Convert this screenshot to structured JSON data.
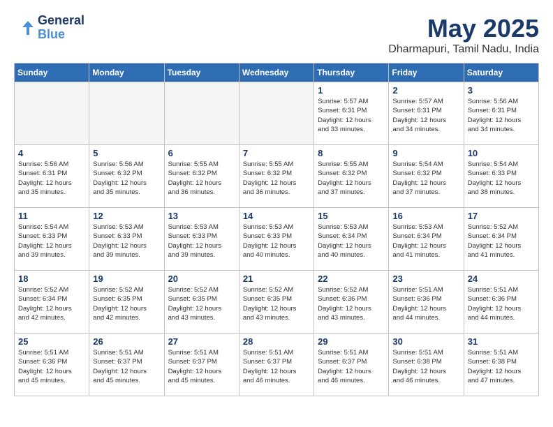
{
  "header": {
    "logo_line1": "General",
    "logo_line2": "Blue",
    "month": "May 2025",
    "location": "Dharmapuri, Tamil Nadu, India"
  },
  "weekdays": [
    "Sunday",
    "Monday",
    "Tuesday",
    "Wednesday",
    "Thursday",
    "Friday",
    "Saturday"
  ],
  "weeks": [
    [
      {
        "day": "",
        "info": ""
      },
      {
        "day": "",
        "info": ""
      },
      {
        "day": "",
        "info": ""
      },
      {
        "day": "",
        "info": ""
      },
      {
        "day": "1",
        "info": "Sunrise: 5:57 AM\nSunset: 6:31 PM\nDaylight: 12 hours\nand 33 minutes."
      },
      {
        "day": "2",
        "info": "Sunrise: 5:57 AM\nSunset: 6:31 PM\nDaylight: 12 hours\nand 34 minutes."
      },
      {
        "day": "3",
        "info": "Sunrise: 5:56 AM\nSunset: 6:31 PM\nDaylight: 12 hours\nand 34 minutes."
      }
    ],
    [
      {
        "day": "4",
        "info": "Sunrise: 5:56 AM\nSunset: 6:31 PM\nDaylight: 12 hours\nand 35 minutes."
      },
      {
        "day": "5",
        "info": "Sunrise: 5:56 AM\nSunset: 6:32 PM\nDaylight: 12 hours\nand 35 minutes."
      },
      {
        "day": "6",
        "info": "Sunrise: 5:55 AM\nSunset: 6:32 PM\nDaylight: 12 hours\nand 36 minutes."
      },
      {
        "day": "7",
        "info": "Sunrise: 5:55 AM\nSunset: 6:32 PM\nDaylight: 12 hours\nand 36 minutes."
      },
      {
        "day": "8",
        "info": "Sunrise: 5:55 AM\nSunset: 6:32 PM\nDaylight: 12 hours\nand 37 minutes."
      },
      {
        "day": "9",
        "info": "Sunrise: 5:54 AM\nSunset: 6:32 PM\nDaylight: 12 hours\nand 37 minutes."
      },
      {
        "day": "10",
        "info": "Sunrise: 5:54 AM\nSunset: 6:33 PM\nDaylight: 12 hours\nand 38 minutes."
      }
    ],
    [
      {
        "day": "11",
        "info": "Sunrise: 5:54 AM\nSunset: 6:33 PM\nDaylight: 12 hours\nand 39 minutes."
      },
      {
        "day": "12",
        "info": "Sunrise: 5:53 AM\nSunset: 6:33 PM\nDaylight: 12 hours\nand 39 minutes."
      },
      {
        "day": "13",
        "info": "Sunrise: 5:53 AM\nSunset: 6:33 PM\nDaylight: 12 hours\nand 39 minutes."
      },
      {
        "day": "14",
        "info": "Sunrise: 5:53 AM\nSunset: 6:33 PM\nDaylight: 12 hours\nand 40 minutes."
      },
      {
        "day": "15",
        "info": "Sunrise: 5:53 AM\nSunset: 6:34 PM\nDaylight: 12 hours\nand 40 minutes."
      },
      {
        "day": "16",
        "info": "Sunrise: 5:53 AM\nSunset: 6:34 PM\nDaylight: 12 hours\nand 41 minutes."
      },
      {
        "day": "17",
        "info": "Sunrise: 5:52 AM\nSunset: 6:34 PM\nDaylight: 12 hours\nand 41 minutes."
      }
    ],
    [
      {
        "day": "18",
        "info": "Sunrise: 5:52 AM\nSunset: 6:34 PM\nDaylight: 12 hours\nand 42 minutes."
      },
      {
        "day": "19",
        "info": "Sunrise: 5:52 AM\nSunset: 6:35 PM\nDaylight: 12 hours\nand 42 minutes."
      },
      {
        "day": "20",
        "info": "Sunrise: 5:52 AM\nSunset: 6:35 PM\nDaylight: 12 hours\nand 43 minutes."
      },
      {
        "day": "21",
        "info": "Sunrise: 5:52 AM\nSunset: 6:35 PM\nDaylight: 12 hours\nand 43 minutes."
      },
      {
        "day": "22",
        "info": "Sunrise: 5:52 AM\nSunset: 6:36 PM\nDaylight: 12 hours\nand 43 minutes."
      },
      {
        "day": "23",
        "info": "Sunrise: 5:51 AM\nSunset: 6:36 PM\nDaylight: 12 hours\nand 44 minutes."
      },
      {
        "day": "24",
        "info": "Sunrise: 5:51 AM\nSunset: 6:36 PM\nDaylight: 12 hours\nand 44 minutes."
      }
    ],
    [
      {
        "day": "25",
        "info": "Sunrise: 5:51 AM\nSunset: 6:36 PM\nDaylight: 12 hours\nand 45 minutes."
      },
      {
        "day": "26",
        "info": "Sunrise: 5:51 AM\nSunset: 6:37 PM\nDaylight: 12 hours\nand 45 minutes."
      },
      {
        "day": "27",
        "info": "Sunrise: 5:51 AM\nSunset: 6:37 PM\nDaylight: 12 hours\nand 45 minutes."
      },
      {
        "day": "28",
        "info": "Sunrise: 5:51 AM\nSunset: 6:37 PM\nDaylight: 12 hours\nand 46 minutes."
      },
      {
        "day": "29",
        "info": "Sunrise: 5:51 AM\nSunset: 6:37 PM\nDaylight: 12 hours\nand 46 minutes."
      },
      {
        "day": "30",
        "info": "Sunrise: 5:51 AM\nSunset: 6:38 PM\nDaylight: 12 hours\nand 46 minutes."
      },
      {
        "day": "31",
        "info": "Sunrise: 5:51 AM\nSunset: 6:38 PM\nDaylight: 12 hours\nand 47 minutes."
      }
    ]
  ]
}
